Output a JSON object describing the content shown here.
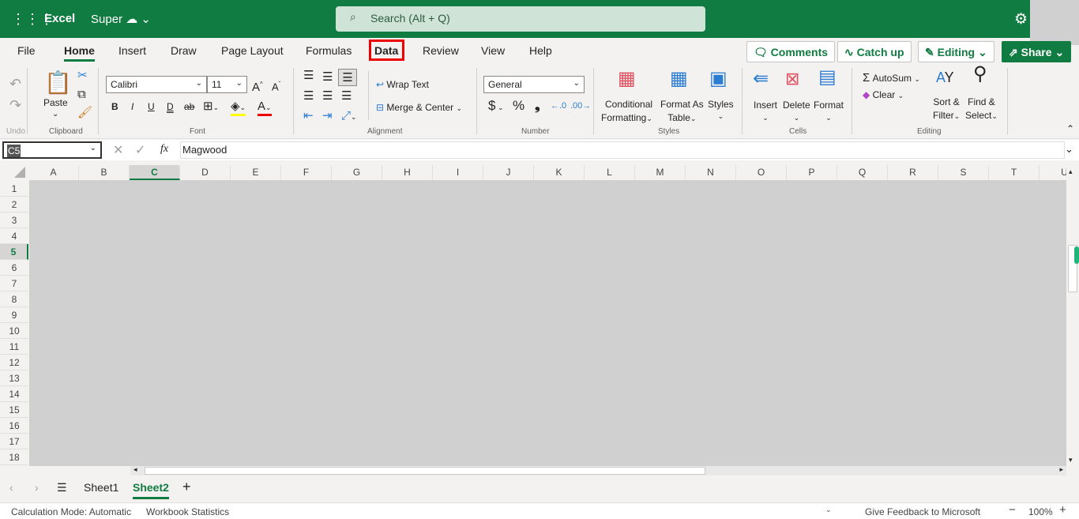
{
  "header": {
    "app_name": "Excel",
    "doc_name": "Super",
    "search_placeholder": "Search (Alt + Q)",
    "icons": [
      "waffle-icon",
      "cloud-sync-icon",
      "chevron-down-icon",
      "search-icon",
      "gear-icon"
    ]
  },
  "tabs": [
    "File",
    "Home",
    "Insert",
    "Draw",
    "Page Layout",
    "Formulas",
    "Data",
    "Review",
    "View",
    "Help"
  ],
  "active_tab": "Home",
  "highlighted_tab": "Data",
  "highlight_color": "#e00000",
  "brand_color": "#107c41",
  "header_buttons": {
    "comments": "Comments",
    "catch_up": "Catch up",
    "editing": "Editing",
    "share": "Share"
  },
  "ribbon": {
    "undo_group": "Undo",
    "clipboard": {
      "paste": "Paste",
      "label": "Clipboard"
    },
    "font": {
      "name": "Calibri",
      "size": "11",
      "label": "Font",
      "bold": "B",
      "italic": "I",
      "underline": "U",
      "double_underline": "D",
      "strike": "ab",
      "font_color_letter": "A"
    },
    "alignment": {
      "wrap": "Wrap Text",
      "merge": "Merge & Center",
      "label": "Alignment"
    },
    "number": {
      "format": "General",
      "currency": "$",
      "percent": "%",
      "comma": "❟",
      "label": "Number"
    },
    "styles": {
      "conditional_1": "Conditional",
      "conditional_2": "Formatting",
      "format_as_1": "Format As",
      "format_as_2": "Table",
      "styles": "Styles",
      "label": "Styles"
    },
    "cells": {
      "insert": "Insert",
      "delete": "Delete",
      "format": "Format",
      "label": "Cells"
    },
    "editing": {
      "autosum": "AutoSum",
      "clear": "Clear",
      "sort_1": "Sort &",
      "sort_2": "Filter",
      "find_1": "Find &",
      "find_2": "Select",
      "label": "Editing"
    }
  },
  "formula_bar": {
    "name_box": "C5",
    "fx": "fx",
    "value": "Magwood"
  },
  "columns": [
    "A",
    "B",
    "C",
    "D",
    "E",
    "F",
    "G",
    "H",
    "I",
    "J",
    "K",
    "L",
    "M",
    "N",
    "O",
    "P",
    "Q",
    "R",
    "S",
    "T",
    "U"
  ],
  "rows": [
    "1",
    "2",
    "3",
    "4",
    "5",
    "6",
    "7",
    "8",
    "9",
    "10",
    "11",
    "12",
    "13",
    "14",
    "15",
    "16",
    "17",
    "18"
  ],
  "selected_column": "C",
  "selected_row": "5",
  "sheets": [
    "Sheet1",
    "Sheet2"
  ],
  "active_sheet": "Sheet2",
  "status": {
    "calc_mode": "Calculation Mode: Automatic",
    "stats": "Workbook Statistics",
    "feedback": "Give Feedback to Microsoft",
    "zoom": "100%"
  }
}
